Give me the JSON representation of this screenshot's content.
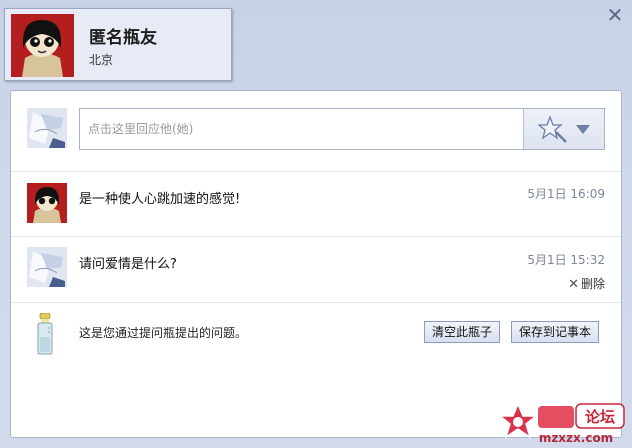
{
  "window": {
    "close_icon": "close-icon"
  },
  "profile": {
    "name": "匿名瓶友",
    "city": "北京"
  },
  "reply": {
    "placeholder": "点击这里回应他(她)",
    "emoji_icon": "magic-wand-icon",
    "dropdown_icon": "chevron-down-icon"
  },
  "messages": [
    {
      "text": "是一种使人心跳加速的感觉!",
      "time": "5月1日 16:09"
    },
    {
      "text": "请问爱情是什么?",
      "time": "5月1日 15:32",
      "delete_label": "删除"
    }
  ],
  "footer": {
    "note": "这是您通过提问瓶提出的问题。",
    "clear_button": "清空此瓶子",
    "save_button": "保存到记事本"
  },
  "watermark": {
    "text_top": "论坛",
    "text_bottom": "mzxzx.com"
  },
  "colors": {
    "accent": "#5a6a88",
    "panel_border": "#aab4cc",
    "button_border": "#8e9bbb"
  }
}
